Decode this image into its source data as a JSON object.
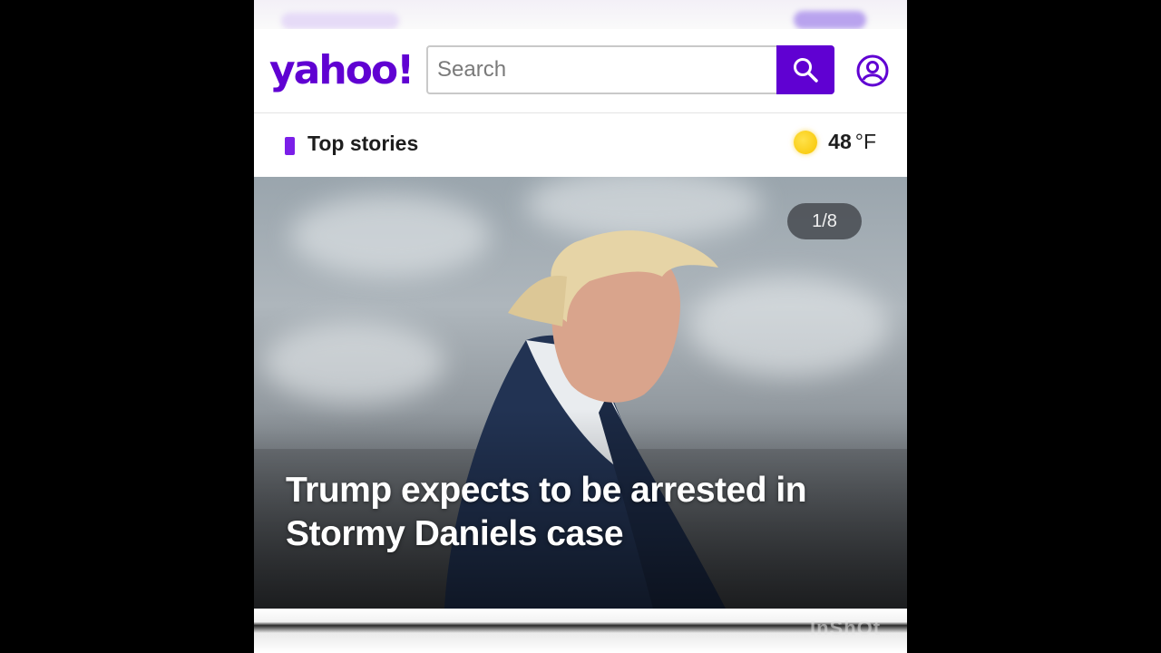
{
  "header": {
    "logo_text": "yahoo!",
    "search": {
      "placeholder": "Search"
    },
    "account_icon": "user-circle-icon",
    "search_icon": "magnifier-icon"
  },
  "section": {
    "title": "Top stories",
    "weather": {
      "temperature": "48",
      "unit": "°F",
      "icon": "sun-icon"
    }
  },
  "hero": {
    "slide_counter": "1/8",
    "headline_line1": "Trump expects to be arrested in",
    "headline_line2": "Stormy Daniels case"
  },
  "watermark": "InShOt",
  "colors": {
    "brand": "#6001d2",
    "accent": "#7b1fe8",
    "sun": "#f7c400"
  }
}
